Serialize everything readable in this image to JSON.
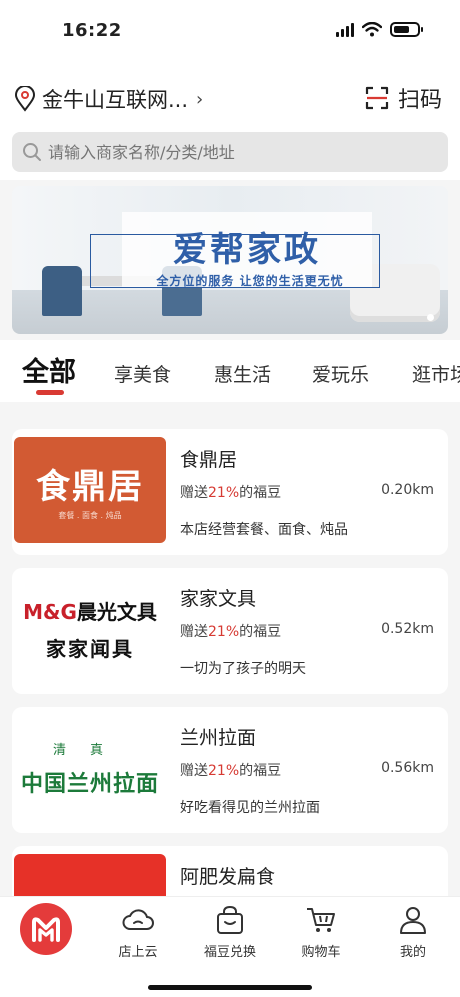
{
  "status": {
    "time": "16:22"
  },
  "location": {
    "name": "金牛山互联网...",
    "chevron": "›"
  },
  "scan": {
    "label": "扫码"
  },
  "search": {
    "placeholder": "请输入商家名称/分类/地址"
  },
  "banner": {
    "title": "爱帮家政",
    "subtitle": "全方位的服务  让您的生活更无忧"
  },
  "tabs": [
    {
      "label": "全部",
      "active": true
    },
    {
      "label": "享美食"
    },
    {
      "label": "惠生活"
    },
    {
      "label": "爱玩乐"
    },
    {
      "label": "逛市场"
    }
  ],
  "shops": [
    {
      "name": "食鼎居",
      "gift_prefix": "赠送",
      "gift_pct": "21%",
      "gift_suffix": "的福豆",
      "distance": "0.20km",
      "desc": "本店经营套餐、面食、炖品",
      "logo_text": "食鼎居",
      "logo_sub": "套餐 . 面食 . 炖品"
    },
    {
      "name": "家家文具",
      "gift_prefix": "赠送",
      "gift_pct": "21%",
      "gift_suffix": "的福豆",
      "distance": "0.52km",
      "desc": "一切为了孩子的明天",
      "logo_top_mark": "M&G",
      "logo_top": "晨光文具",
      "logo_bottom": "家家闻具"
    },
    {
      "name": "兰州拉面",
      "gift_prefix": "赠送",
      "gift_pct": "21%",
      "gift_suffix": "的福豆",
      "distance": "0.56km",
      "desc": "好吃看得见的兰州拉面",
      "logo_top": "清真",
      "logo_bottom": "中国兰州拉面"
    },
    {
      "name": "阿肥发扁食"
    }
  ],
  "nav": [
    {
      "label": "",
      "icon": "home-logo-icon"
    },
    {
      "label": "店上云",
      "icon": "cloud-icon"
    },
    {
      "label": "福豆兑换",
      "icon": "bag-icon"
    },
    {
      "label": "购物车",
      "icon": "cart-icon"
    },
    {
      "label": "我的",
      "icon": "user-icon"
    }
  ],
  "colors": {
    "accent": "#d93a33",
    "banner_text": "#2f5fa8"
  }
}
